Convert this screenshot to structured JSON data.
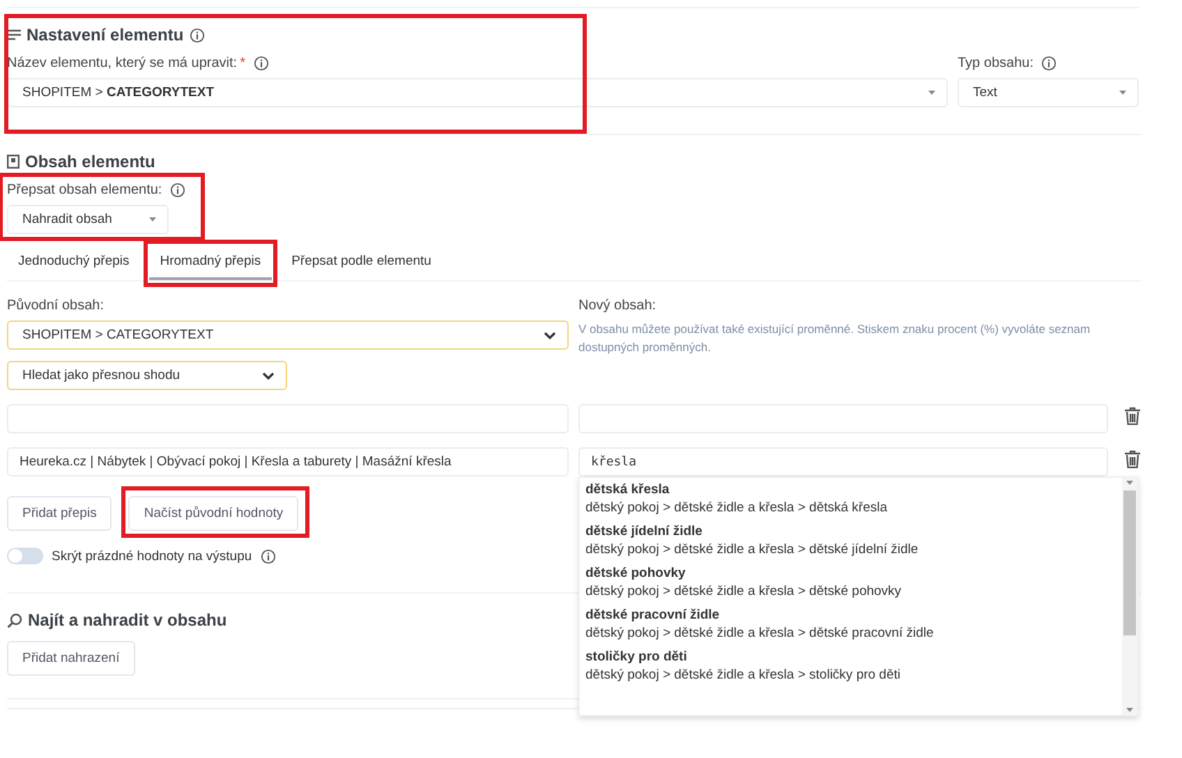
{
  "element_settings": {
    "title": "Nastavení elementu",
    "name_label": "Název elementu, který se má upravit:",
    "required_mark": "*",
    "name_value_prefix": "SHOPITEM > ",
    "name_value_bold": "CATEGORYTEXT",
    "type_label": "Typ obsahu:",
    "type_value": "Text"
  },
  "element_content": {
    "title": "Obsah elementu",
    "overwrite_label": "Přepsat obsah elementu:",
    "overwrite_value": "Nahradit obsah",
    "tabs": [
      {
        "label": "Jednoduchý přepis",
        "selected": false
      },
      {
        "label": "Hromadný přepis",
        "selected": true
      },
      {
        "label": "Přepsat podle elementu",
        "selected": false
      }
    ],
    "original_label": "Původní obsah:",
    "original_value": "SHOPITEM > CATEGORYTEXT",
    "match_value": "Hledat jako přesnou shodu",
    "new_label": "Nový obsah:",
    "new_help": "V obsahu můžete používat také existující proměnné. Stiskem znaku procent (%) vyvoláte seznam dostupných proměnných.",
    "rows": [
      {
        "original": "",
        "new": ""
      },
      {
        "original": "Heureka.cz | Nábytek | Obývací pokoj | Křesla a taburety | Masážní křesla",
        "new": "křesla"
      }
    ],
    "suggestions": [
      {
        "name": "dětská křesla",
        "path": "dětský pokoj > dětské židle a křesla > dětská křesla"
      },
      {
        "name": "dětské jídelní židle",
        "path": "dětský pokoj > dětské židle a křesla > dětské jídelní židle"
      },
      {
        "name": "dětské pohovky",
        "path": "dětský pokoj > dětské židle a křesla > dětské pohovky"
      },
      {
        "name": "dětské pracovní židle",
        "path": "dětský pokoj > dětské židle a křesla > dětské pracovní židle"
      },
      {
        "name": "stoličky pro děti",
        "path": "dětský pokoj > dětské židle a křesla > stoličky pro děti"
      }
    ],
    "buttons": [
      "Přidat přepis",
      "Načíst původní hodnoty"
    ],
    "hide_empty": {
      "label": "Skrýt prázdné hodnoty na výstupu",
      "on": false
    }
  },
  "find_replace": {
    "title": "Najít a nahradit v obsahu",
    "button": "Přidat nahrazení"
  }
}
